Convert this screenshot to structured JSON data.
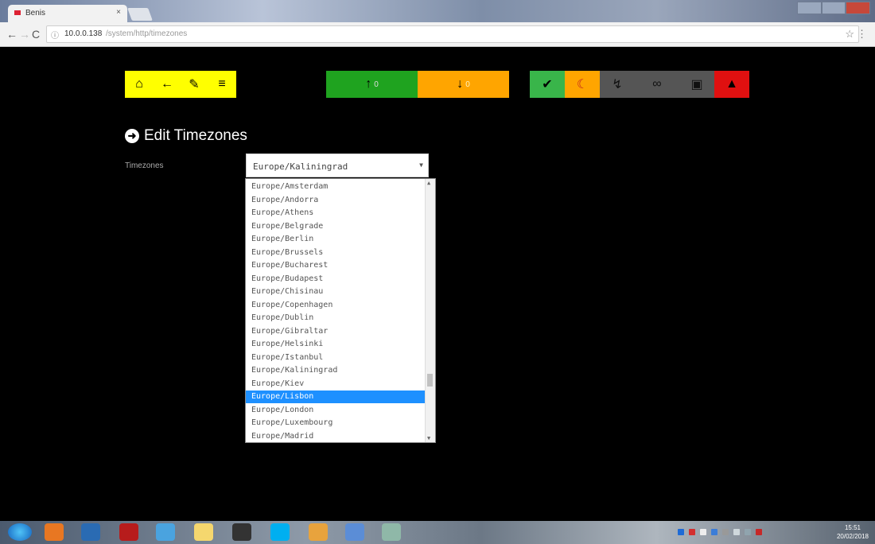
{
  "browser": {
    "tab_title": "Benis",
    "tab_close": "×",
    "url_host": "10.0.0.138",
    "url_path": "/system/http/timezones",
    "nav_back": "←",
    "nav_forward": "→",
    "nav_reload": "C",
    "info_icon": "ⓘ",
    "star": "☆",
    "menu": "⋮"
  },
  "toolbar": {
    "home": "⌂",
    "back": "←",
    "tools": "✎",
    "menu": "≡",
    "up_arrow": "↑",
    "up_count": "0",
    "down_arrow": "↓",
    "down_count": "0",
    "plug": "✔",
    "moon": "☾",
    "bolt": "↯",
    "link": "∞",
    "lock": "▣",
    "alert": "▲"
  },
  "page": {
    "title_icon": "➜",
    "title": "Edit Timezones",
    "timezones_label": "Timezones",
    "selected_value": "Europe/Kaliningrad",
    "select_caret": "▼"
  },
  "dropdown": {
    "options": [
      "Europe/Amsterdam",
      "Europe/Andorra",
      "Europe/Athens",
      "Europe/Belgrade",
      "Europe/Berlin",
      "Europe/Brussels",
      "Europe/Bucharest",
      "Europe/Budapest",
      "Europe/Chisinau",
      "Europe/Copenhagen",
      "Europe/Dublin",
      "Europe/Gibraltar",
      "Europe/Helsinki",
      "Europe/Istanbul",
      "Europe/Kaliningrad",
      "Europe/Kiev",
      "Europe/Lisbon",
      "Europe/London",
      "Europe/Luxembourg",
      "Europe/Madrid"
    ],
    "highlighted": "Europe/Lisbon",
    "scroll_up": "▲",
    "scroll_down": "▼"
  },
  "taskbar": {
    "clock_time": "15:51",
    "clock_date": "20/02/2018"
  },
  "colors": {
    "yellow": "#ffff00",
    "green": "#1fa31f",
    "orange": "#ffa500",
    "gray": "#555555",
    "red": "#e01010",
    "selection": "#1e90ff"
  }
}
